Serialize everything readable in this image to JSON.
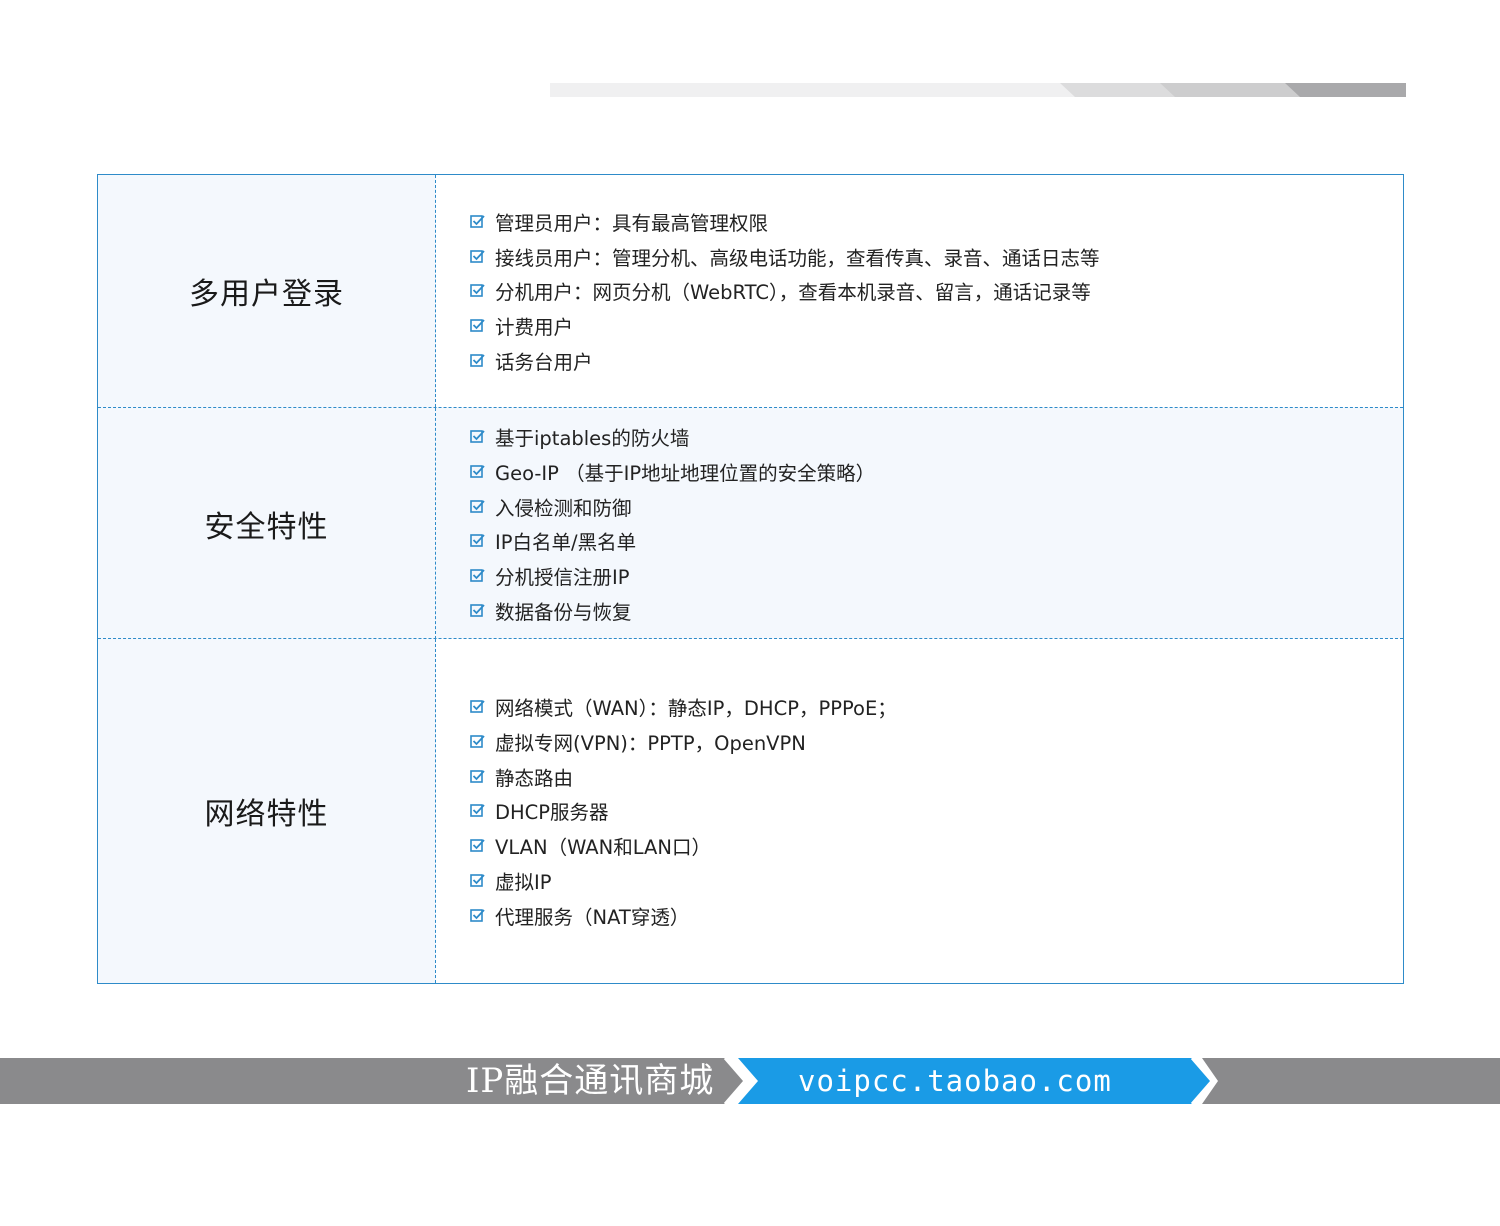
{
  "colors": {
    "accent_blue": "#2e8bc9",
    "light_fill": "#f4f8fd",
    "footer_gray": "#8a8a8c",
    "footer_blue": "#1a9be6"
  },
  "sections": [
    {
      "title": "多用户登录",
      "items": [
        "管理员用户：具有最高管理权限",
        "接线员用户：管理分机、高级电话功能，查看传真、录音、通话日志等",
        "分机用户：网页分机（WebRTC），查看本机录音、留言，通话记录等",
        "计费用户",
        "话务台用户"
      ]
    },
    {
      "title": "安全特性",
      "items": [
        "基于iptables的防火墙",
        "Geo-IP （基于IP地址地理位置的安全策略）",
        "入侵检测和防御",
        "IP白名单/黑名单",
        "分机授信注册IP",
        "数据备份与恢复"
      ]
    },
    {
      "title": "网络特性",
      "items": [
        "网络模式（WAN）：静态IP，DHCP，PPPoE；",
        "虚拟专网(VPN)：PPTP，OpenVPN",
        "静态路由",
        "DHCP服务器",
        "VLAN（WAN和LAN口）",
        "虚拟IP",
        "代理服务（NAT穿透）"
      ]
    }
  ],
  "footer": {
    "store_name": "IP融合通讯商城",
    "store_url": "voipcc.taobao.com"
  }
}
